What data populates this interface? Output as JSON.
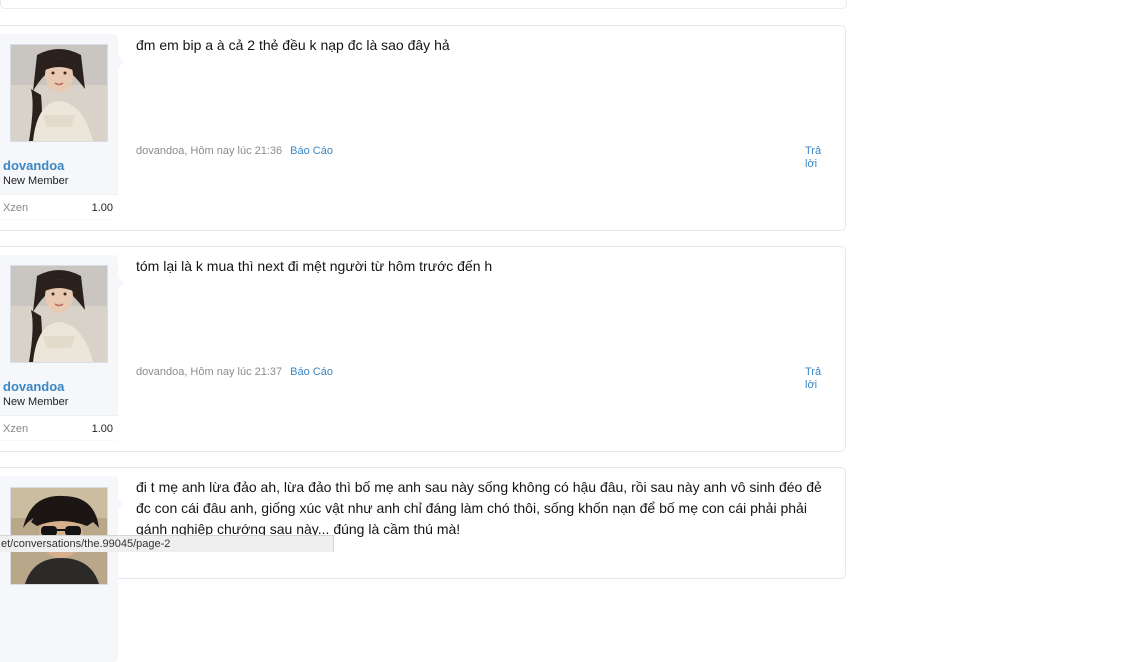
{
  "posts": [
    {
      "username": "dovandoa",
      "user_title": "New Member",
      "stat_name": "Xzen",
      "stat_value": "1.00",
      "message": "đm em bip a à cả 2 thẻ đều k nạp đc là sao đây hả",
      "meta": "dovandoa, Hôm nay lúc 21:36",
      "report_label": "Báo Cáo",
      "reply_label": "Trả lời"
    },
    {
      "username": "dovandoa",
      "user_title": "New Member",
      "stat_name": "Xzen",
      "stat_value": "1.00",
      "message": "tóm lại là k mua thì next đi mệt người từ hôm trước đến h",
      "meta": "dovandoa, Hôm nay lúc 21:37",
      "report_label": "Báo Cáo",
      "reply_label": "Trả lời"
    },
    {
      "message": "đi t mẹ anh lừa đảo ah, lừa đảo thì bố mẹ anh sau này sống không có hậu đâu, rồi sau này anh vô sinh đéo đẻ đc con cái đâu anh, giống xúc vật như anh chỉ đáng làm chó thôi, sống khốn nạn để bố mẹ con cái phải phải gánh nghiệp chướng sau này... đúng là cầm thú mà!"
    }
  ],
  "status_bar": {
    "url": "et/conversations/the.99045/page-2"
  }
}
